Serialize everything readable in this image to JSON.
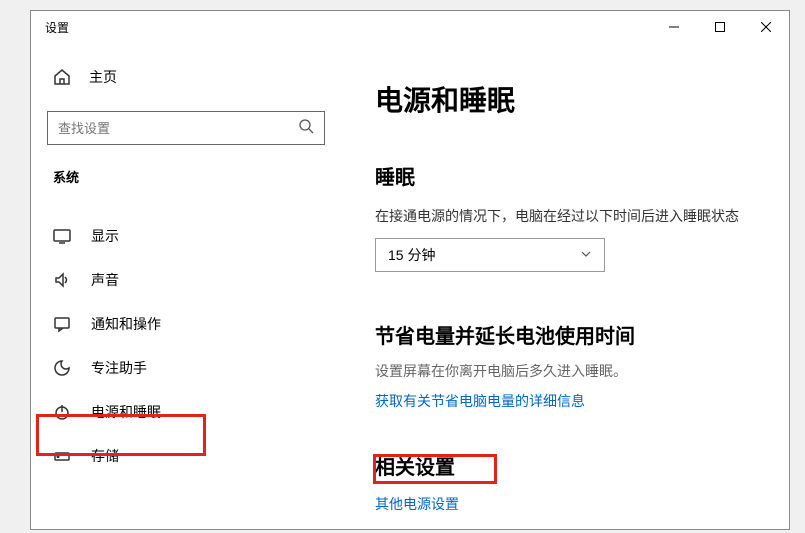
{
  "titlebar": {
    "title": "设置"
  },
  "sidebar": {
    "home": "主页",
    "search_placeholder": "查找设置",
    "section": "系统",
    "items": [
      {
        "label": "显示"
      },
      {
        "label": "声音"
      },
      {
        "label": "通知和操作"
      },
      {
        "label": "专注助手"
      },
      {
        "label": "电源和睡眠"
      },
      {
        "label": "存储"
      }
    ]
  },
  "main": {
    "title": "电源和睡眠",
    "sleep_title": "睡眠",
    "sleep_desc": "在接通电源的情况下，电脑在经过以下时间后进入睡眠状态",
    "sleep_value": "15 分钟",
    "battery_title": "节省电量并延长电池使用时间",
    "battery_desc": "设置屏幕在你离开电脑后多久进入睡眠。",
    "battery_link": "获取有关节省电脑电量的详细信息",
    "related_title": "相关设置",
    "related_link": "其他电源设置"
  }
}
